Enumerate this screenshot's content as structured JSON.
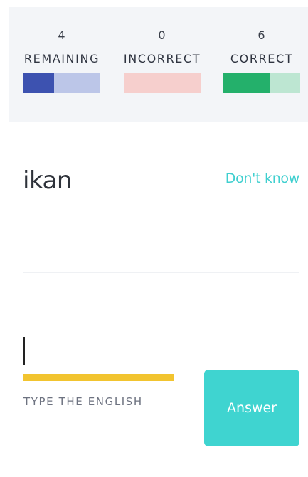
{
  "progress": {
    "remaining": {
      "count": "4",
      "label": "REMAINING",
      "fill_fraction": 0.4,
      "fill_color": "#3d52b0",
      "rest_color": "#bcc6e8"
    },
    "incorrect": {
      "count": "0",
      "label": "INCORRECT",
      "fill_fraction": 0,
      "fill_color": "#e87a78",
      "rest_color": "#f6cfcd"
    },
    "correct": {
      "count": "6",
      "label": "CORRECT",
      "fill_fraction": 0.6,
      "fill_color": "#24b06b",
      "rest_color": "#bde6d2"
    }
  },
  "prompt": {
    "word": "ikan",
    "dont_know_label": "Don't know"
  },
  "answer": {
    "value": "",
    "hint": "TYPE THE ENGLISH",
    "button_label": "Answer"
  },
  "colors": {
    "accent": "#3fd4d0",
    "underline": "#f2c42f"
  }
}
